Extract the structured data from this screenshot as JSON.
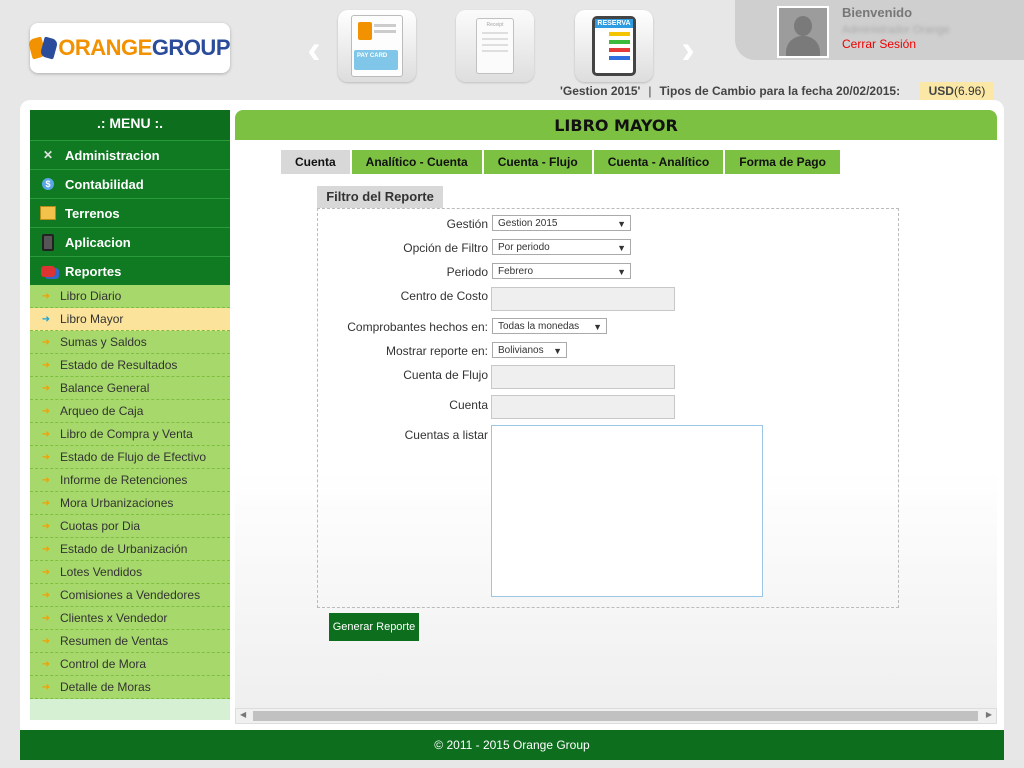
{
  "brand": {
    "logo_text_orange": "ORANGE",
    "logo_text_blue": "GROUP"
  },
  "header": {
    "nav_prev": "‹",
    "nav_next": "›",
    "tiles": [
      {
        "name": "pay-card",
        "caption": "PAY CARD"
      },
      {
        "name": "receipt",
        "caption": "Receipt"
      },
      {
        "name": "reserva",
        "caption": "RESERVA"
      }
    ],
    "welcome": "Bienvenido",
    "user_name": "Administrador Orange",
    "logout": "Cerrar Sesión"
  },
  "infobar": {
    "gestion": "'Gestion 2015'",
    "separator": "|",
    "exchange_label": "Tipos de Cambio para la fecha 20/02/2015:",
    "currency": "USD",
    "rate": "(6.96)"
  },
  "colors": {
    "primary_green": "#0d6e1e",
    "light_green": "#7cc142",
    "menu_green": "#a7d86c",
    "active_yellow": "#fbe39b",
    "logout_red": "#e00000"
  },
  "sidebar": {
    "title": ".: MENU :.",
    "main_items": [
      {
        "label": "Administracion",
        "icon": "tools-icon"
      },
      {
        "label": "Contabilidad",
        "icon": "money-bag-icon"
      },
      {
        "label": "Terrenos",
        "icon": "map-icon"
      },
      {
        "label": "Aplicacion",
        "icon": "phone-icon"
      },
      {
        "label": "Reportes",
        "icon": "reports-icon"
      }
    ],
    "sub_items": [
      {
        "label": "Libro Diario"
      },
      {
        "label": "Libro Mayor",
        "active": true
      },
      {
        "label": "Sumas y Saldos"
      },
      {
        "label": "Estado de Resultados"
      },
      {
        "label": "Balance General"
      },
      {
        "label": "Arqueo de Caja"
      },
      {
        "label": "Libro de Compra y Venta"
      },
      {
        "label": "Estado de Flujo de Efectivo"
      },
      {
        "label": "Informe de Retenciones"
      },
      {
        "label": "Mora Urbanizaciones"
      },
      {
        "label": "Cuotas por Dia"
      },
      {
        "label": "Estado de Urbanización"
      },
      {
        "label": "Lotes Vendidos"
      },
      {
        "label": "Comisiones a Vendedores"
      },
      {
        "label": "Clientes x Vendedor"
      },
      {
        "label": "Resumen de Ventas"
      },
      {
        "label": "Control de Mora"
      },
      {
        "label": "Detalle de Moras"
      }
    ]
  },
  "main": {
    "title": "LIBRO MAYOR",
    "tabs": [
      "Cuenta",
      "Analítico - Cuenta",
      "Cuenta - Flujo",
      "Cuenta - Analítico",
      "Forma de Pago"
    ],
    "active_tab": "Cuenta",
    "filter_title": "Filtro del Reporte",
    "form": {
      "gestion": {
        "label": "Gestión",
        "value": "Gestion 2015"
      },
      "opcion": {
        "label": "Opción de Filtro",
        "value": "Por periodo"
      },
      "periodo": {
        "label": "Periodo",
        "value": "Febrero"
      },
      "centro": {
        "label": "Centro de Costo",
        "value": ""
      },
      "comprobantes": {
        "label": "Comprobantes hechos en:",
        "value": "Todas la monedas"
      },
      "mostrar": {
        "label": "Mostrar reporte en:",
        "value": "Bolivianos"
      },
      "cuenta_flujo": {
        "label": "Cuenta de Flujo",
        "value": ""
      },
      "cuenta": {
        "label": "Cuenta",
        "value": ""
      },
      "cuentas_listar": {
        "label": "Cuentas a listar",
        "value": ""
      }
    },
    "generate_button": "Generar Reporte"
  },
  "footer": {
    "text": "© 2011 - 2015 Orange Group"
  }
}
